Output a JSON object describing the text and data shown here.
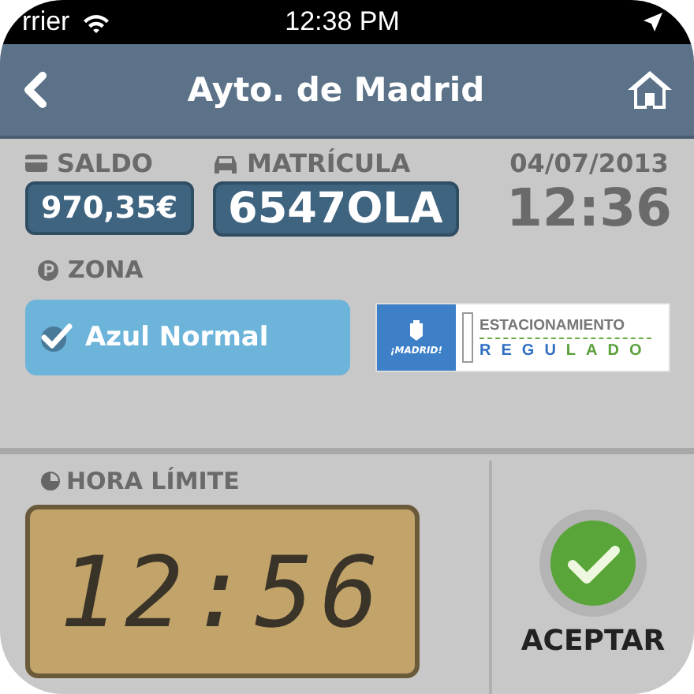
{
  "status_bar": {
    "carrier": "rrier",
    "time": "12:38 PM"
  },
  "nav_bar": {
    "title": "Ayto. de Madrid"
  },
  "saldo": {
    "label": "SALDO",
    "value": "970,35€"
  },
  "matricula": {
    "label": "MATRÍCULA",
    "value": "6547OLA"
  },
  "date": "04/07/2013",
  "clock": "12:36",
  "zona": {
    "label": "ZONA",
    "options": [
      {
        "label": "Azul Normal",
        "checked": true
      }
    ]
  },
  "logo": {
    "city": "¡MADRID!",
    "line_1": "ESTACIONAMIENTO",
    "line_2": "REGULADO"
  },
  "hora_limite": {
    "label": "HORA LÍMITE",
    "value": "12:56"
  },
  "accept_button": {
    "label": "ACEPTAR"
  }
}
